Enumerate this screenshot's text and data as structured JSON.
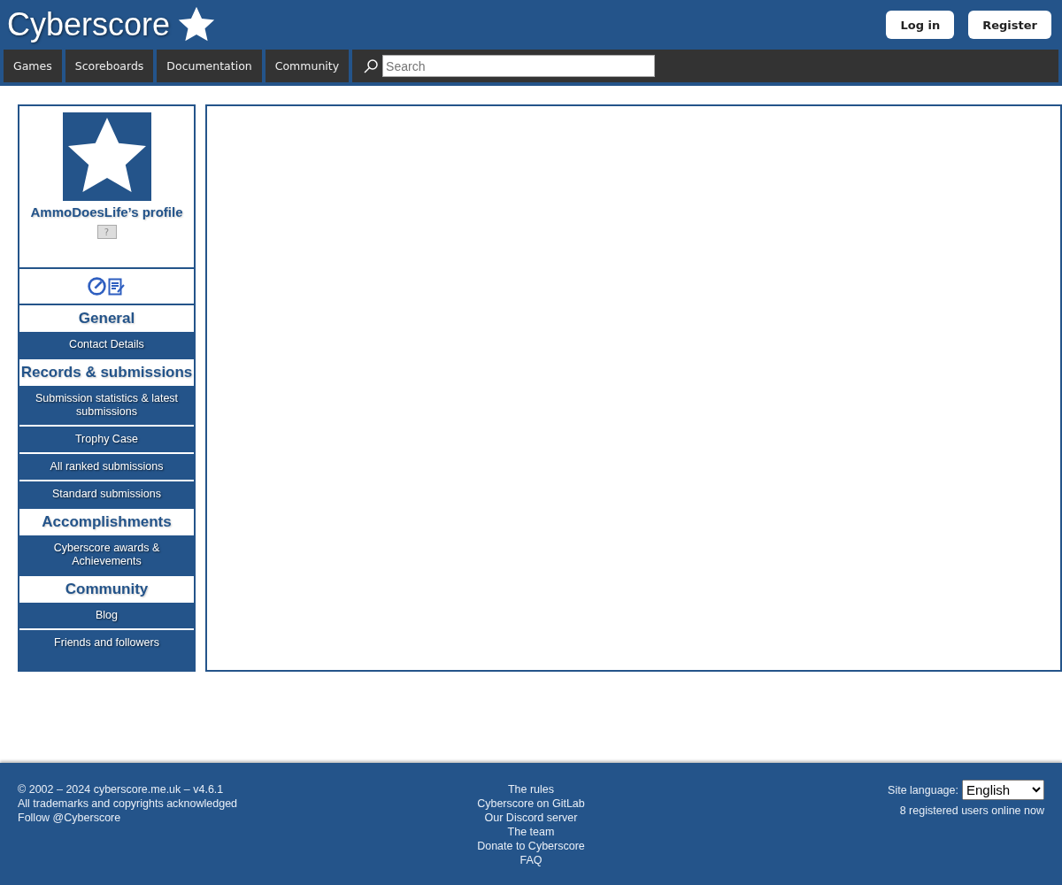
{
  "header": {
    "logo": "Cyberscore",
    "buttons": [
      "Log in",
      "Register"
    ]
  },
  "nav": {
    "items": [
      "Games",
      "Scoreboards",
      "Documentation",
      "Community"
    ],
    "search": {
      "placeholder": "Search"
    }
  },
  "profile": {
    "title": "AmmoDoesLife’s profile",
    "badge": "?"
  },
  "sidebar": [
    {
      "kind": "heading",
      "label": "General"
    },
    {
      "kind": "link",
      "label": "Contact Details"
    },
    {
      "kind": "heading",
      "label": "Records & submissions"
    },
    {
      "kind": "link",
      "label": "Submission statistics & latest submissions"
    },
    {
      "kind": "link",
      "label": "Trophy Case"
    },
    {
      "kind": "link",
      "label": "All ranked submissions"
    },
    {
      "kind": "link",
      "label": "Standard submissions"
    },
    {
      "kind": "heading",
      "label": "Accomplishments"
    },
    {
      "kind": "link",
      "label": "Cyberscore awards & Achievements"
    },
    {
      "kind": "heading",
      "label": "Community"
    },
    {
      "kind": "link",
      "label": "Blog"
    },
    {
      "kind": "link",
      "label": "Friends and followers"
    }
  ],
  "footer": {
    "left": [
      "© 2002 – 2024 cyberscore.me.uk – v4.6.1",
      "All trademarks and copyrights acknowledged",
      "Follow @Cyberscore"
    ],
    "links": [
      "The rules",
      "Cyberscore on GitLab",
      "Our Discord server",
      "The team",
      "Donate to Cyberscore",
      "FAQ"
    ],
    "language_label": "Site language:",
    "language": "English",
    "online": "8 registered users online now"
  }
}
